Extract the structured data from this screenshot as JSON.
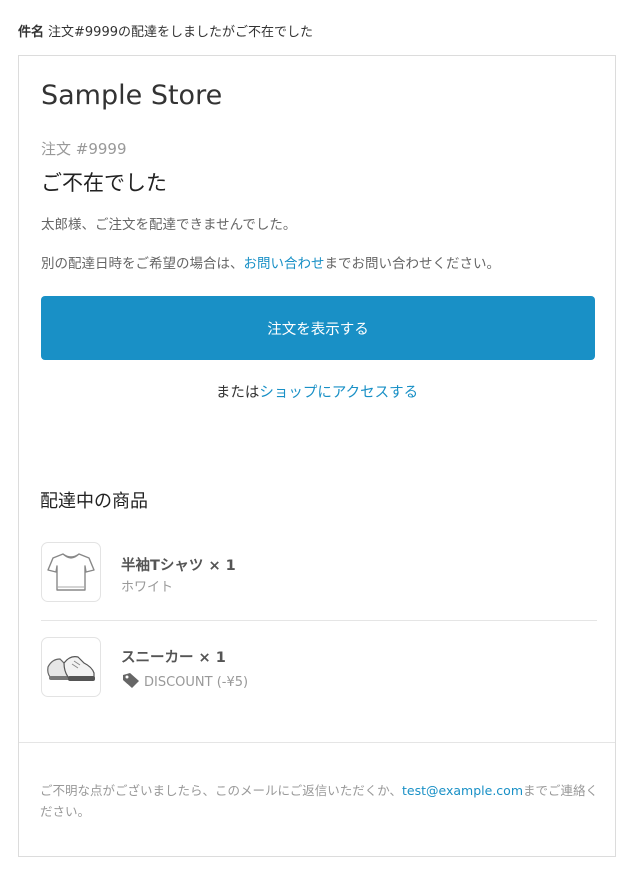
{
  "subject": {
    "label": "件名",
    "text": "注文#9999の配達をしましたがご不在でした"
  },
  "store": {
    "name": "Sample Store"
  },
  "order": {
    "number": "注文 #9999"
  },
  "headline": "ご不在でした",
  "message": {
    "line1": "太郎様、ご注文を配達できませんでした。",
    "line2_before": "別の配達日時をご希望の場合は、",
    "line2_link": "お問い合わせ",
    "line2_after": "までお問い合わせください。"
  },
  "button": {
    "label": "注文を表示する"
  },
  "shop_access": {
    "prefix": "または",
    "link": "ショップにアクセスする"
  },
  "section_title": "配達中の商品",
  "items": [
    {
      "name": "半袖Tシャツ × 1",
      "variant": "ホワイト",
      "icon": "tshirt-icon"
    },
    {
      "name": "スニーカー × 1",
      "discount": "DISCOUNT (-¥5)",
      "icon": "sneakers-icon"
    }
  ],
  "footer": {
    "text_before": "ご不明な点がございましたら、このメールにご返信いただくか、",
    "email": "test@example.com",
    "text_after": "までご連絡ください。"
  },
  "colors": {
    "accent": "#1990c6",
    "text": "#333333",
    "muted": "#999999",
    "border": "#dcdcdc"
  }
}
